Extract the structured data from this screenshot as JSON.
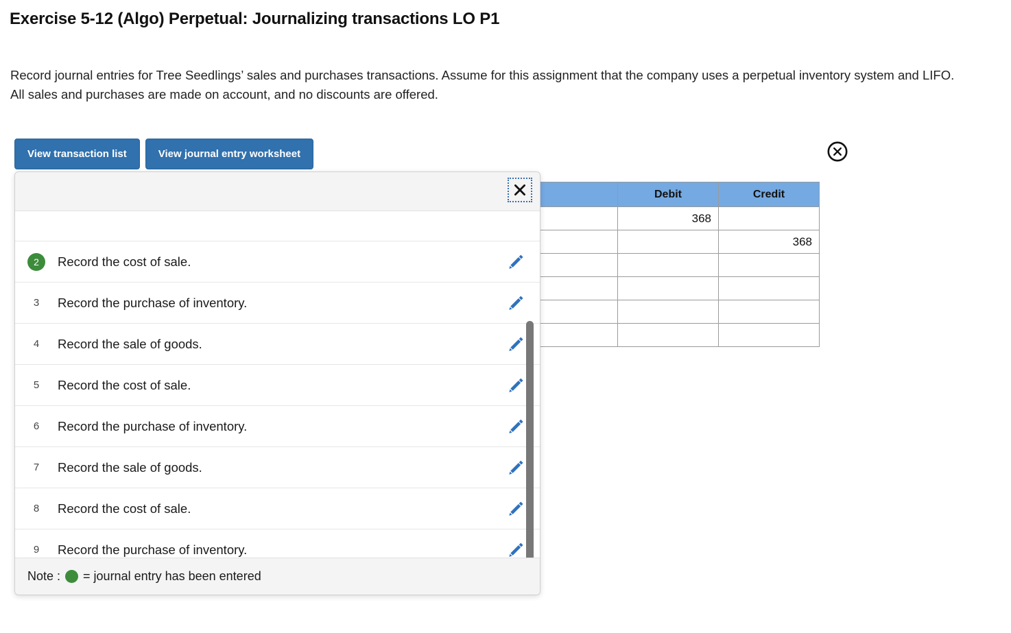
{
  "page": {
    "title": "Exercise 5-12 (Algo) Perpetual: Journalizing transactions LO P1",
    "instructions": "Record journal entries for Tree Seedlings’ sales and purchases transactions. Assume for this assignment that the company uses a perpetual inventory system and LIFO. All sales and purchases are made on account, and no discounts are offered."
  },
  "toolbar": {
    "view_transaction_list": "View transaction list",
    "view_journal_entry_worksheet": "View journal entry worksheet",
    "close_icon": "circle-close-icon"
  },
  "journal_table": {
    "headers": [
      "",
      "Debit",
      "Credit"
    ],
    "rows": [
      {
        "account": "",
        "debit": "368",
        "credit": ""
      },
      {
        "account": "",
        "debit": "",
        "credit": "368"
      },
      {
        "account": "",
        "debit": "",
        "credit": ""
      },
      {
        "account": "",
        "debit": "",
        "credit": ""
      },
      {
        "account": "",
        "debit": "",
        "credit": ""
      },
      {
        "account": "",
        "debit": "",
        "credit": ""
      }
    ]
  },
  "popover": {
    "close_label": "✕",
    "close_icon": "close-icon",
    "edit_icon": "pencil-icon",
    "note_prefix": "Note :",
    "note_text": "= journal entry has been entered",
    "transactions": [
      {
        "num": "",
        "text": "",
        "entered": false,
        "partial": true
      },
      {
        "num": "2",
        "text": "Record the cost of sale.",
        "entered": true,
        "partial": false
      },
      {
        "num": "3",
        "text": "Record the purchase of inventory.",
        "entered": false,
        "partial": false
      },
      {
        "num": "4",
        "text": "Record the sale of goods.",
        "entered": false,
        "partial": false
      },
      {
        "num": "5",
        "text": "Record the cost of sale.",
        "entered": false,
        "partial": false
      },
      {
        "num": "6",
        "text": "Record the purchase of inventory.",
        "entered": false,
        "partial": false
      },
      {
        "num": "7",
        "text": "Record the sale of goods.",
        "entered": false,
        "partial": false
      },
      {
        "num": "8",
        "text": "Record the cost of sale.",
        "entered": false,
        "partial": false
      },
      {
        "num": "9",
        "text": "Record the purchase of inventory.",
        "entered": false,
        "partial": false
      }
    ]
  },
  "colors": {
    "button_blue": "#3071ae",
    "table_header_blue": "#74a9e2",
    "entered_green": "#3c8c3c",
    "pencil_blue": "#2f72bd"
  }
}
